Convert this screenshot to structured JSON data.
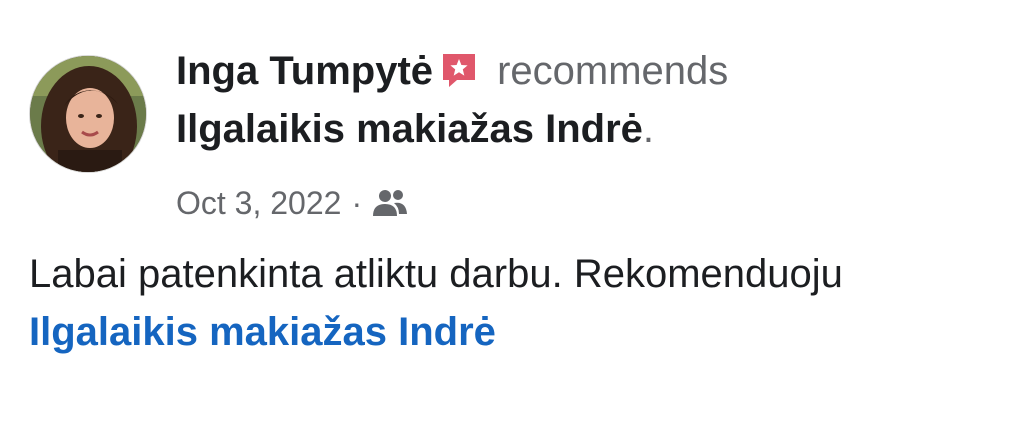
{
  "post": {
    "author_name": "Inga Tumpytė",
    "verb": "recommends",
    "page_name": "Ilgalaikis makiažas Indrė",
    "period": ".",
    "date": "Oct 3, 2022",
    "separator": "·",
    "body": "Labai patenkinta atliktu darbu. Rekomenduoju",
    "tagged_page": "Ilgalaikis makiažas Indrė"
  },
  "icons": {
    "recommend": "recommend-star-icon",
    "audience": "friends-icon"
  },
  "colors": {
    "primary_text": "#1c1e21",
    "secondary_text": "#65676b",
    "link": "#1565c0",
    "recommend_badge": "#e0576b"
  }
}
